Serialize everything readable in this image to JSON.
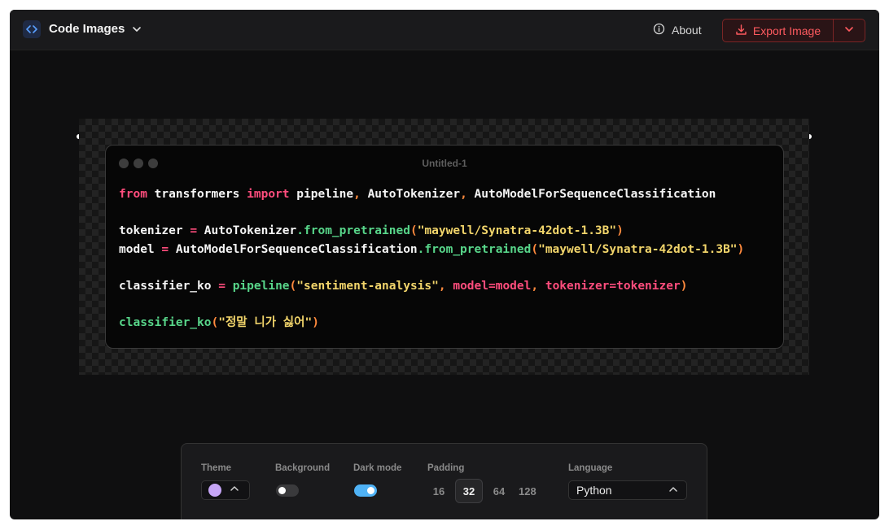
{
  "app": {
    "title": "Code Images",
    "about_label": "About",
    "export_label": "Export Image"
  },
  "editor": {
    "file_title": "Untitled-1",
    "lines": [
      [
        {
          "t": "from",
          "c": "kw"
        },
        {
          "t": " transformers ",
          "c": ""
        },
        {
          "t": "import",
          "c": "kw"
        },
        {
          "t": " pipeline",
          "c": ""
        },
        {
          "t": ",",
          "c": "punc"
        },
        {
          "t": " AutoTokenizer",
          "c": ""
        },
        {
          "t": ",",
          "c": "punc"
        },
        {
          "t": " AutoModelForSequenceClassification",
          "c": ""
        }
      ],
      [],
      [
        {
          "t": "tokenizer ",
          "c": ""
        },
        {
          "t": "=",
          "c": "op"
        },
        {
          "t": " AutoTokenizer",
          "c": ""
        },
        {
          "t": ".",
          "c": "fn"
        },
        {
          "t": "from_pretrained",
          "c": "fn"
        },
        {
          "t": "(",
          "c": "punc"
        },
        {
          "t": "\"maywell/Synatra-42dot-1.3B\"",
          "c": "str"
        },
        {
          "t": ")",
          "c": "punc"
        }
      ],
      [
        {
          "t": "model ",
          "c": ""
        },
        {
          "t": "=",
          "c": "op"
        },
        {
          "t": " AutoModelForSequenceClassification",
          "c": ""
        },
        {
          "t": ".",
          "c": "fn"
        },
        {
          "t": "from_pretrained",
          "c": "fn"
        },
        {
          "t": "(",
          "c": "punc"
        },
        {
          "t": "\"maywell/Synatra-42dot-1.3B\"",
          "c": "str"
        },
        {
          "t": ")",
          "c": "punc"
        }
      ],
      [],
      [
        {
          "t": "classifier_ko ",
          "c": ""
        },
        {
          "t": "=",
          "c": "op"
        },
        {
          "t": " ",
          "c": ""
        },
        {
          "t": "pipeline",
          "c": "fn"
        },
        {
          "t": "(",
          "c": "punc"
        },
        {
          "t": "\"sentiment-analysis\"",
          "c": "str"
        },
        {
          "t": ",",
          "c": "punc"
        },
        {
          "t": " model=model",
          "c": "kw"
        },
        {
          "t": ",",
          "c": "punc"
        },
        {
          "t": " tokenizer=tokenizer",
          "c": "kw"
        },
        {
          "t": ")",
          "c": "punc"
        }
      ],
      [],
      [
        {
          "t": "classifier_ko",
          "c": "fn"
        },
        {
          "t": "(",
          "c": "punc"
        },
        {
          "t": "\"정말 니가 싫어\"",
          "c": "str"
        },
        {
          "t": ")",
          "c": "punc"
        }
      ]
    ]
  },
  "toolbar": {
    "theme_label": "Theme",
    "theme_color": "#c7a6f7",
    "background_label": "Background",
    "background_on": false,
    "darkmode_label": "Dark mode",
    "darkmode_on": true,
    "padding_label": "Padding",
    "padding_options": [
      "16",
      "32",
      "64",
      "128"
    ],
    "padding_selected": "32",
    "language_label": "Language",
    "language_value": "Python"
  },
  "colors": {
    "accent_red": "#ff5a5f",
    "toggle_on": "#4fb2f5",
    "toggle_off": "#3a3a3c"
  }
}
